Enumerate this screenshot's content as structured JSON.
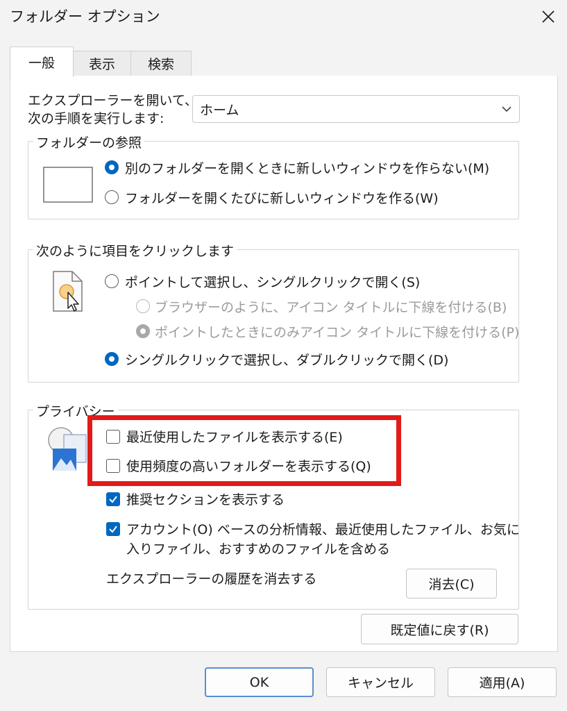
{
  "window": {
    "title": "フォルダー オプション",
    "close_icon": "close-icon"
  },
  "tabs": [
    {
      "label": "一般",
      "active": true
    },
    {
      "label": "表示",
      "active": false
    },
    {
      "label": "検索",
      "active": false
    }
  ],
  "open_explorer": {
    "label_line1": "エクスプローラーを開いて、",
    "label_line2": "次の手順を実行します:",
    "selected": "ホーム"
  },
  "browse_folders": {
    "legend": "フォルダーの参照",
    "option_same_window": "別のフォルダーを開くときに新しいウィンドウを作らない(M)",
    "option_new_window": "フォルダーを開くたびに新しいウィンドウを作る(W)"
  },
  "click_items": {
    "legend": "次のように項目をクリックします",
    "option_single_click": "ポイントして選択し、シングルクリックで開く(S)",
    "sub_underline_browser": "ブラウザーのように、アイコン タイトルに下線を付ける(B)",
    "sub_underline_point": "ポイントしたときにのみアイコン タイトルに下線を付ける(P)",
    "option_double_click": "シングルクリックで選択し、ダブルクリックで開く(D)"
  },
  "privacy": {
    "legend": "プライバシー",
    "show_recent_files": "最近使用したファイルを表示する(E)",
    "show_frequent_folders": "使用頻度の高いフォルダーを表示する(Q)",
    "show_recommended": "推奨セクションを表示する",
    "include_account_line1": "アカウント(O) ベースの分析情報、最近使用したファイル、お気に",
    "include_account_line2": "入りファイル、おすすめのファイルを含める",
    "clear_history_label": "エクスプローラーの履歴を消去する",
    "clear_button": "消去(C)"
  },
  "restore_defaults": "既定値に戻す(R)",
  "footer": {
    "ok": "OK",
    "cancel": "キャンセル",
    "apply": "適用(A)"
  },
  "colors": {
    "accent": "#0067c0",
    "highlight": "#e21a1a"
  }
}
